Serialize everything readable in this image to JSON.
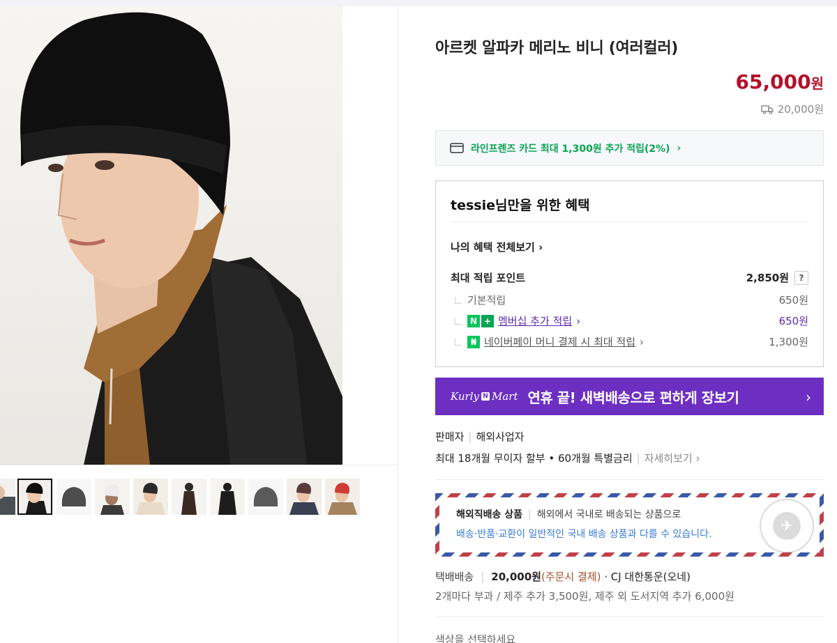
{
  "product": {
    "title": "아르켓 알파카 메리노 비니 (여러컬러)",
    "price": "65,000",
    "price_unit": "원",
    "shipping_price": "20,000원"
  },
  "card_promo": {
    "text": "라인프렌즈 카드 최대 1,300원 추가 적립(2%)"
  },
  "benefits": {
    "heading": "tessie님만을 위한 혜택",
    "view_all": "나의 혜택 전체보기",
    "max_points_label": "최대 적립 포인트",
    "max_points_value": "2,850원",
    "help": "?",
    "rows": [
      {
        "label": "기본적립",
        "value": "650원"
      },
      {
        "label": "멤버십 추가 적립",
        "value": "650원"
      },
      {
        "label": "네이버페이 머니 결제 시 최대 적립",
        "value": "1,300원"
      }
    ]
  },
  "banner": {
    "logo_left": "Kurly",
    "logo_n": "N",
    "logo_right": "Mart",
    "message": "연휴 끝! 새벽배송으로 편하게 장보기"
  },
  "seller": {
    "label": "판매자",
    "value": "해외사업자"
  },
  "installment": {
    "text": "최대 18개월 무이자 할부 • 60개월 특별금리",
    "more": "자세히보기"
  },
  "overseas": {
    "title": "해외직배송 상품",
    "desc": "해외에서 국내로 배송되는 상품으로",
    "notice": "배송·반품·교환이 일반적인 국내 배송 상품과 다를 수 있습니다."
  },
  "shipping": {
    "label": "택배배송",
    "fee": "20,000원",
    "fee_note": "(주문시 결제)",
    "carrier": "· CJ 대한통운(오네)",
    "extra": "2개마다 부과 / 제주 추가 3,500원, 제주 외 도서지역 추가 6,000원"
  },
  "options": {
    "prompt": "색상을 선택하세요"
  },
  "colors": {
    "price_red": "#b3112c",
    "promo_green": "#0aa454",
    "banner_purple": "#6d2fc2",
    "link_purple": "#5b2bb0"
  }
}
